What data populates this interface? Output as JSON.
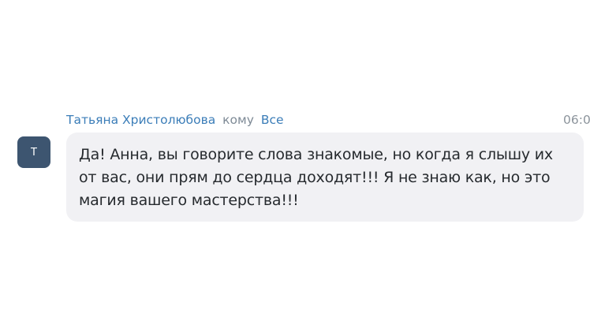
{
  "message": {
    "sender": "Татьяна Христолюбова",
    "to_word": "кому",
    "recipient": "Все",
    "time": "06:0",
    "avatar_letter": "Т",
    "text": "Да! Анна, вы говорите слова знакомые, но когда я слышу их от вас, они прям до сердца доходят!!! Я не знаю как, но это магия вашего мастерства!!!"
  },
  "colors": {
    "sender_link": "#3b7db8",
    "avatar_bg": "#3d5570",
    "bubble_bg": "#f1f1f4",
    "text": "#262a2e",
    "muted": "#7e8a96"
  }
}
